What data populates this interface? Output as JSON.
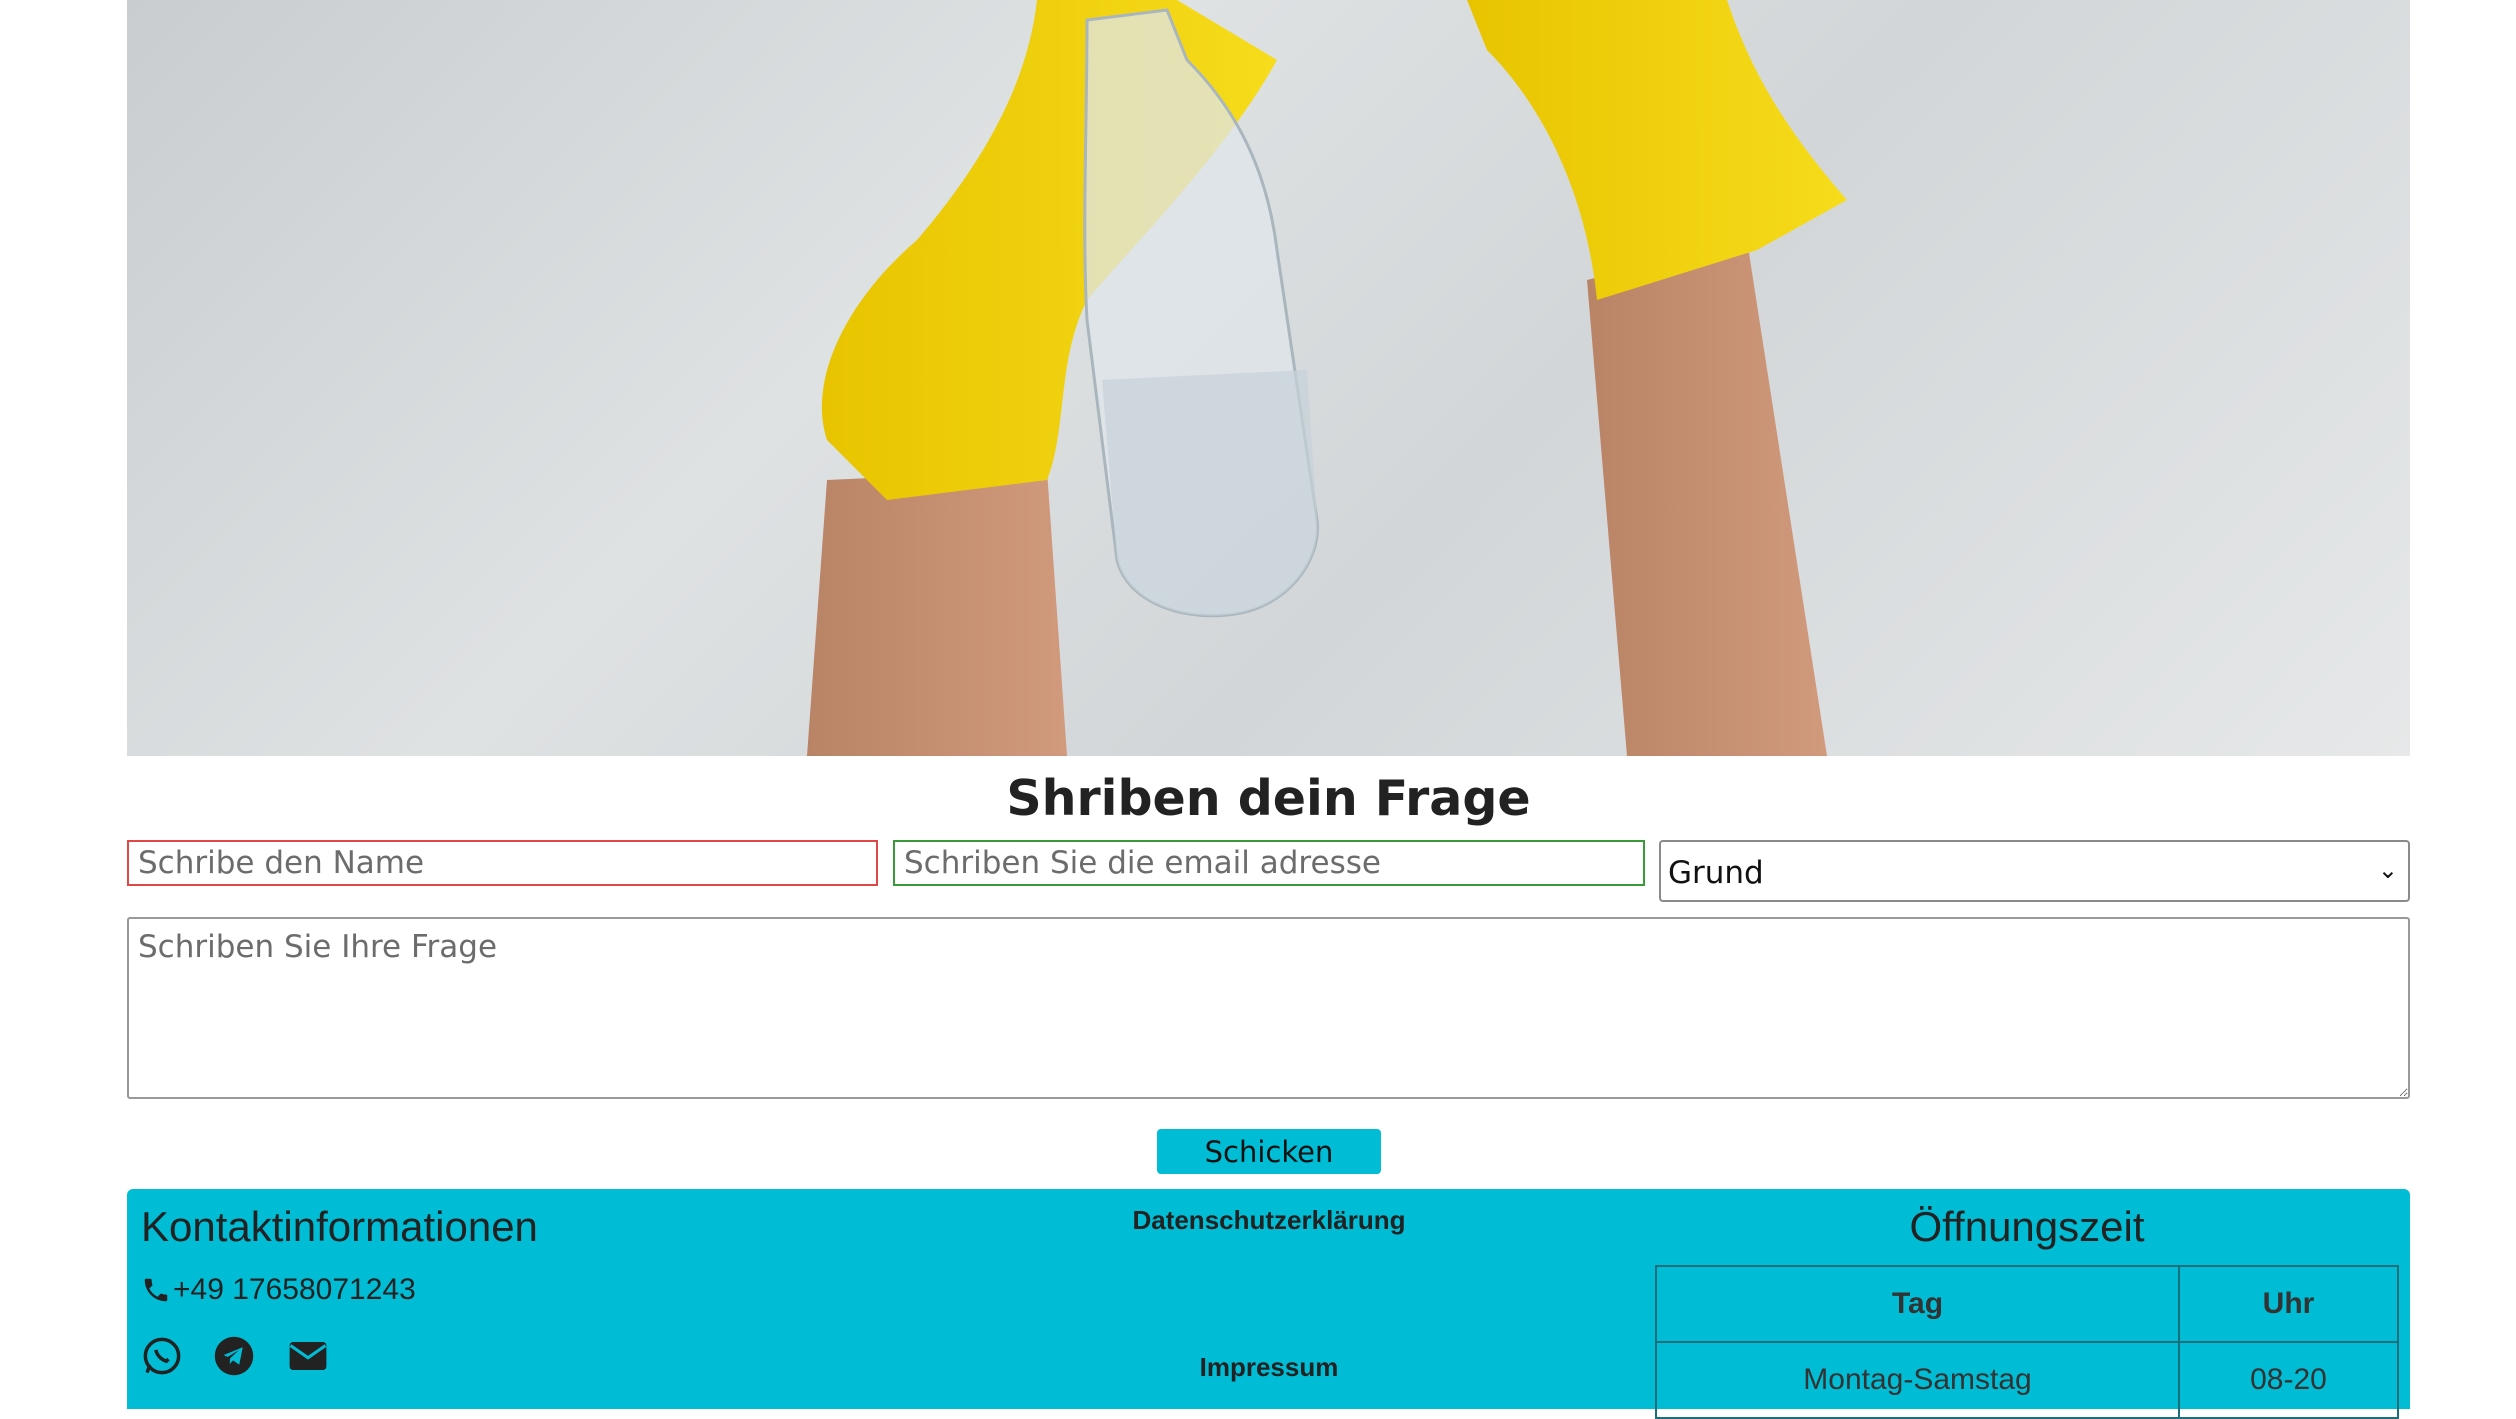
{
  "form": {
    "title": "Shriben dein Frage",
    "name_placeholder": "Schribe den Name",
    "email_placeholder": "Schriben Sie die email adresse",
    "reason_selected": "Grund",
    "question_placeholder": "Schriben Sie Ihre Frage",
    "submit_label": "Schicken"
  },
  "footer": {
    "contact_title": "Kontaktinformationen",
    "phone": "+49 17658071243",
    "privacy_label": "Datenschutzerklärung",
    "imprint_label": "Impressum",
    "hours_title": "Öffnungszeit",
    "table_headers": [
      "Tag",
      "Uhr"
    ],
    "table_rows": [
      [
        "Montag-Samstag",
        "08-20"
      ]
    ]
  },
  "colors": {
    "accent": "#00bcd4",
    "name_border": "#e04848",
    "email_border": "#3a9a3a"
  },
  "icons": [
    "phone-icon",
    "whatsapp-icon",
    "telegram-icon",
    "email-icon"
  ]
}
